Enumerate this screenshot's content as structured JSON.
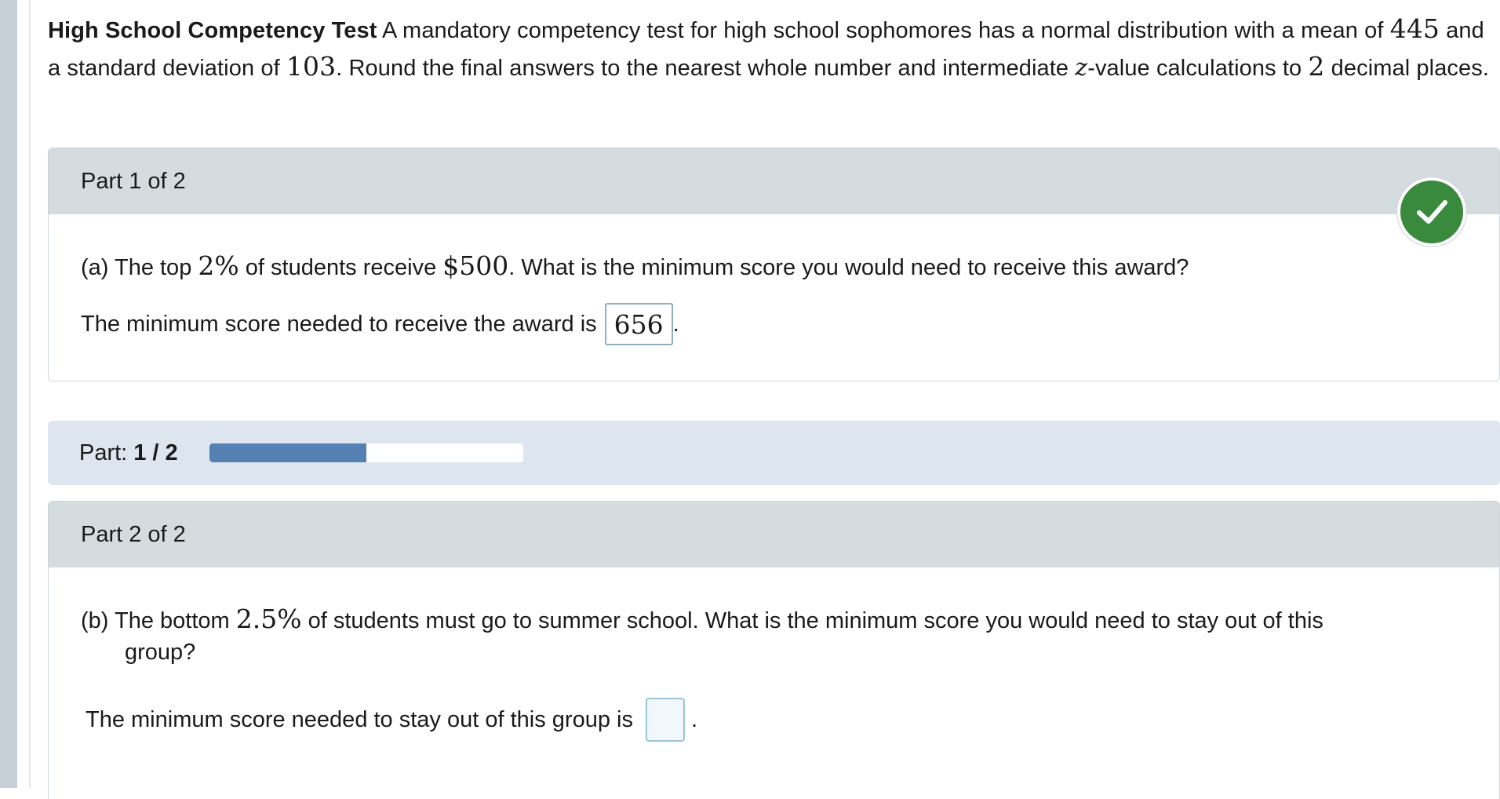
{
  "intro": {
    "title": "High School Competency Test",
    "t1": " A mandatory competency test for high school sophomores has a normal distribution with a mean of ",
    "mean": "445",
    "t2": " and a standard deviation of ",
    "sd": "103",
    "t3": ". Round the final answers to the nearest whole number and intermediate ",
    "z": "z",
    "t4": "-value calculations to ",
    "decimals": "2",
    "t5": " decimal places."
  },
  "part1": {
    "header": "Part 1 of 2",
    "status_icon": "check-icon",
    "status_color": "#3a8a3d",
    "q_prefix": "(a) The top ",
    "q_pct": "2%",
    "q_mid": " of students receive ",
    "q_amount": "$500",
    "q_suffix": ". What is the minimum score you would need to receive this award?",
    "answer_label": "The minimum score needed to receive the award is",
    "answer_value": "656",
    "answer_end": "."
  },
  "progress": {
    "label": "Part: ",
    "value_text": "1 / 2",
    "fraction": 0.5,
    "fill_color": "#5580b3"
  },
  "part2": {
    "header": "Part 2 of 2",
    "q_prefix": "(b) The bottom ",
    "q_pct": "2.5%",
    "q_suffix": " of students must go to summer school. What is the minimum score you would need to stay out of this",
    "q_suffix2": "group?",
    "answer_label": "The minimum score needed to stay out of this group is",
    "answer_value": "",
    "answer_end": "."
  }
}
